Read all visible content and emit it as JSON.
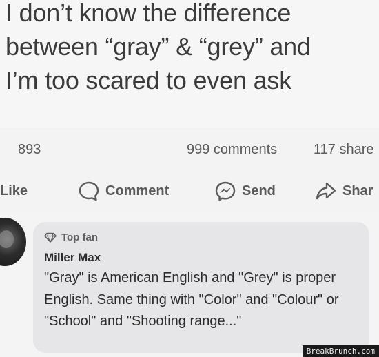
{
  "post": {
    "lines": [
      "I don’t know the difference",
      "between “gray” & “grey” and",
      "I’m too scared to even ask"
    ]
  },
  "stats": {
    "reactions": "893",
    "comments": "999 comments",
    "shares": "117 share"
  },
  "actions": {
    "like": "Like",
    "comment": "Comment",
    "send": "Send",
    "share": "Shar"
  },
  "comment": {
    "badge": "Top fan",
    "author": "Miller Max",
    "text": "\"Gray\" is American English and \"Grey\" is proper English. Same thing with \"Color\" and \"Colour\" or \"School\" and \"Shooting range...\""
  },
  "watermark": "BreakBrunch.com",
  "icons": {
    "like": "thumbs-up-icon",
    "comment": "comment-bubble-icon",
    "send": "messenger-icon",
    "share": "share-arrow-icon",
    "badge": "diamond-icon"
  },
  "colors": {
    "background": "#f4f4f4",
    "bubble": "#e6e6e9",
    "text": "#2b2b2b",
    "muted": "#5b5b5b"
  }
}
